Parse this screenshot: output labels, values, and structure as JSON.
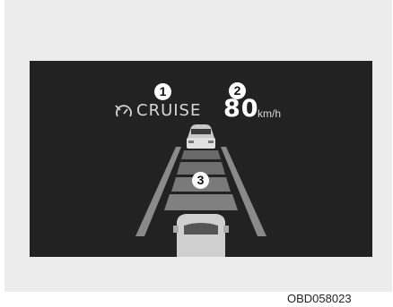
{
  "display": {
    "cruise_label": "CRUISE",
    "speed_value": "80",
    "speed_unit": "km/h",
    "cruise_icon": "cruise-control-icon",
    "vehicle_distance_levels": 3
  },
  "markers": {
    "marker_1": "1",
    "marker_2": "2",
    "marker_3": "3"
  },
  "image_code": "OBD058023",
  "colors": {
    "background": "#ececec",
    "screen": "#222222",
    "text": "#d6d6d6",
    "lane_line": "#8a8a8a"
  }
}
